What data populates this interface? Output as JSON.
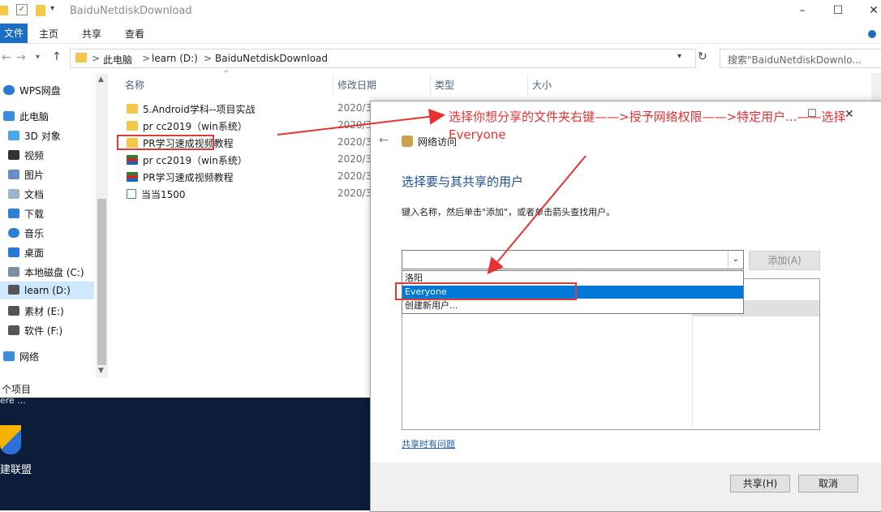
{
  "window": {
    "title": "BaiduNetdiskDownload"
  },
  "ribbon": {
    "tabs": [
      "文件",
      "主页",
      "共享",
      "查看"
    ]
  },
  "address": {
    "parts": [
      "此电脑",
      "learn (D:)",
      "BaiduNetdiskDownload"
    ],
    "separator": ">"
  },
  "search": {
    "placeholder": "搜索\"BaiduNetdiskDownlo..."
  },
  "nav": {
    "items": [
      "WPS网盘",
      "此电脑",
      "3D 对象",
      "视频",
      "图片",
      "文档",
      "下载",
      "音乐",
      "桌面",
      "本地磁盘 (C:)",
      "learn (D:)",
      "素材 (E:)",
      "软件 (F:)",
      "网络"
    ],
    "selected": "learn (D:)"
  },
  "columns": [
    "名称",
    "修改日期",
    "类型",
    "大小"
  ],
  "files": [
    {
      "name": "5.Android学科--项目实战",
      "date": "2020/3",
      "kind": "folder"
    },
    {
      "name": "pr cc2019（win系统）",
      "date": "2020/3",
      "kind": "folder"
    },
    {
      "name": "PR学习速成视频教程",
      "date": "2020/3",
      "kind": "folder"
    },
    {
      "name": "pr cc2019（win系统）",
      "date": "2020/3",
      "kind": "archive"
    },
    {
      "name": "PR学习速成视频教程",
      "date": "2020/3",
      "kind": "archive"
    },
    {
      "name": "当当1500",
      "date": "2020/3",
      "kind": "doc"
    }
  ],
  "status": {
    "items": "个项目"
  },
  "desktop": {
    "text1": "ere ...",
    "icon_label": "建联盟"
  },
  "dialog": {
    "title": "网络访问",
    "heading": "选择要与其共享的用户",
    "instruction": "键入名称，然后单击\"添加\"，或者单击箭头查找用户。",
    "add_button": "添加(A)",
    "options": [
      "洛阳",
      "Everyone",
      "创建新用户..."
    ],
    "selected_option": "Everyone",
    "help_link": "共享时有问题",
    "share_button": "共享(H)",
    "cancel_button": "取消"
  },
  "annotation": {
    "text": "选择你想分享的文件夹右键——>授予网络权限——>特定用户...——选择Everyone"
  },
  "colors": {
    "accent": "#1a6fc4",
    "annotation": "#e83232",
    "selection": "#0078d7"
  }
}
